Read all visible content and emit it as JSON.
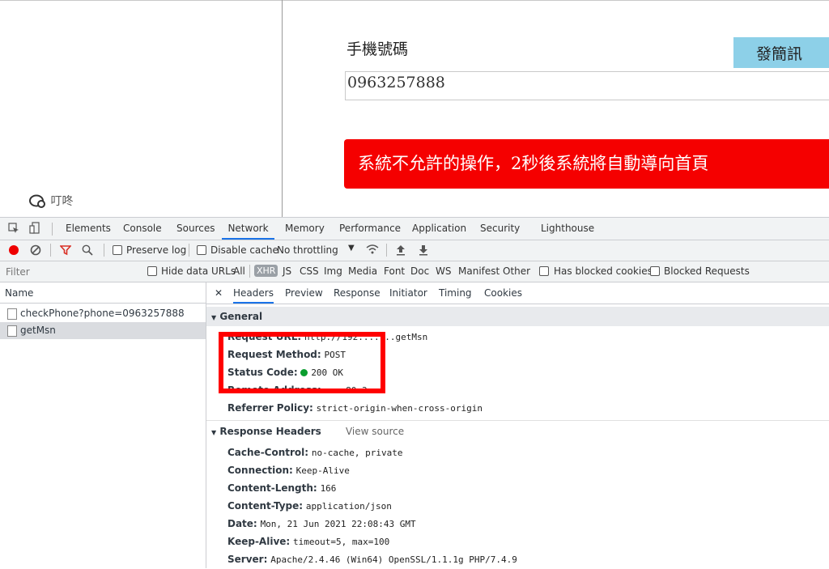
{
  "page": {
    "phone_label": "手機號碼",
    "sms_button": "發簡訊",
    "phone_value": "0963257888",
    "alert_text": "系統不允許的操作，2秒後系統將自動導向首頁",
    "chat_label": "叮咚"
  },
  "devtools": {
    "tabs": [
      "Elements",
      "Console",
      "Sources",
      "Network",
      "Memory",
      "Performance",
      "Application",
      "Security",
      "Lighthouse"
    ],
    "active_tab": "Network",
    "toolbar": {
      "preserve_log": "Preserve log",
      "disable_cache": "Disable cache",
      "throttling": "No throttling"
    },
    "filter": {
      "placeholder": "Filter",
      "hide_data_urls": "Hide data URLs",
      "types": [
        "All",
        "XHR",
        "JS",
        "CSS",
        "Img",
        "Media",
        "Font",
        "Doc",
        "WS",
        "Manifest",
        "Other"
      ],
      "has_blocked_cookies": "Has blocked cookies",
      "blocked_requests": "Blocked Requests"
    },
    "name_header": "Name",
    "requests": [
      "checkPhone?phone=0963257888",
      "getMsn"
    ],
    "detail_tabs": [
      "Headers",
      "Preview",
      "Response",
      "Initiator",
      "Timing",
      "Cookies"
    ],
    "general": {
      "title": "General",
      "request_url_label": "Request URL:",
      "request_url_value": "http://192.......getMsn",
      "method_label": "Request Method:",
      "method_value": "POST",
      "status_label": "Status Code:",
      "status_value": "200 OK",
      "remote_label": "Remote Address:",
      "remote_value": "...:80.3",
      "referrer_label": "Referrer Policy:",
      "referrer_value": "strict-origin-when-cross-origin"
    },
    "response_headers": {
      "title": "Response Headers",
      "view_source": "View source",
      "rows": [
        {
          "k": "Cache-Control:",
          "v": "no-cache, private"
        },
        {
          "k": "Connection:",
          "v": "Keep-Alive"
        },
        {
          "k": "Content-Length:",
          "v": "166"
        },
        {
          "k": "Content-Type:",
          "v": "application/json"
        },
        {
          "k": "Date:",
          "v": "Mon, 21 Jun 2021 22:08:43 GMT"
        },
        {
          "k": "Keep-Alive:",
          "v": "timeout=5, max=100"
        },
        {
          "k": "Server:",
          "v": "Apache/2.4.46 (Win64) OpenSSL/1.1.1g PHP/7.4.9"
        }
      ]
    }
  }
}
